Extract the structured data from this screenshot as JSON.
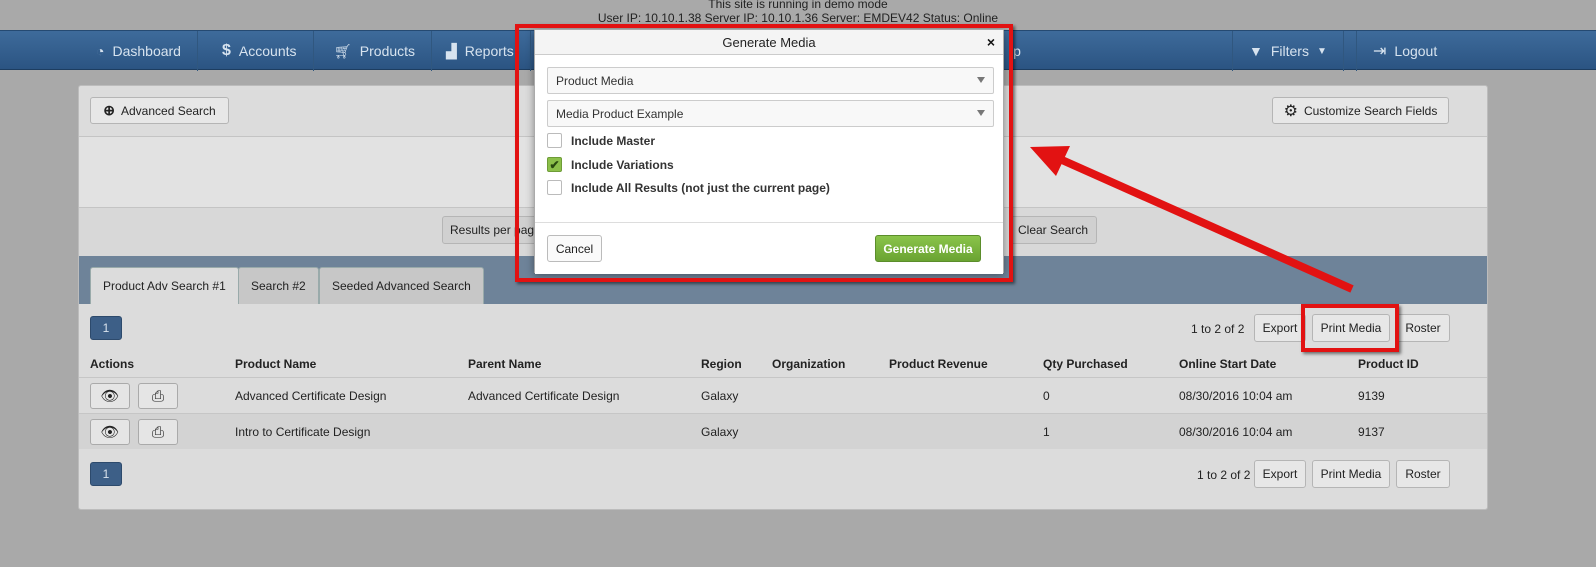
{
  "banner": {
    "line1": "This site is running in demo mode",
    "line2": "User IP: 10.10.1.38 Server IP: 10.10.1.36 Server: EMDEV42 Status: Online"
  },
  "nav": {
    "dashboard": "Dashboard",
    "accounts": "Accounts",
    "products": "Products",
    "reports": "Reports",
    "help_partial": "lp",
    "filters": "Filters",
    "logout": "Logout"
  },
  "toolbar": {
    "advanced_search": "Advanced Search",
    "customize_fields": "Customize Search Fields",
    "results_per_page_partial": "Results per pag",
    "clear_search": "Clear Search"
  },
  "tabs": [
    {
      "label": "Product Adv Search #1",
      "active": true
    },
    {
      "label": "Search #2",
      "active": false
    },
    {
      "label": "Seeded Advanced Search",
      "active": false
    }
  ],
  "pagination": {
    "page": "1",
    "count_top": "1 to 2 of 2",
    "count_bottom": "1 to 2 of 2",
    "export": "Export",
    "print_media": "Print Media",
    "roster": "Roster"
  },
  "table": {
    "headers": [
      "Actions",
      "Product Name",
      "Parent Name",
      "Region",
      "Organization",
      "Product Revenue",
      "Qty Purchased",
      "Online Start Date",
      "Product ID"
    ],
    "rows": [
      {
        "product_name": "Advanced Certificate Design",
        "parent_name": "Advanced Certificate Design",
        "region": "Galaxy",
        "organization": "",
        "revenue": "",
        "qty": "0",
        "start_date": "08/30/2016 10:04 am",
        "product_id": "9139"
      },
      {
        "product_name": "Intro to Certificate Design",
        "parent_name": "",
        "region": "Galaxy",
        "organization": "",
        "revenue": "",
        "qty": "1",
        "start_date": "08/30/2016 10:04 am",
        "product_id": "9137"
      }
    ]
  },
  "modal": {
    "title": "Generate Media",
    "close": "×",
    "select1": "Product Media",
    "select2": "Media Product Example",
    "checks": [
      {
        "label": "Include Master",
        "checked": false
      },
      {
        "label": "Include Variations",
        "checked": true
      },
      {
        "label": "Include All Results (not just the current page)",
        "checked": false
      }
    ],
    "cancel": "Cancel",
    "generate": "Generate Media"
  },
  "colors": {
    "nav_bg": "#2f5a88",
    "annotation_red": "#e21212",
    "generate_green": "#7ab83e",
    "page_btn": "#3d5f87"
  }
}
